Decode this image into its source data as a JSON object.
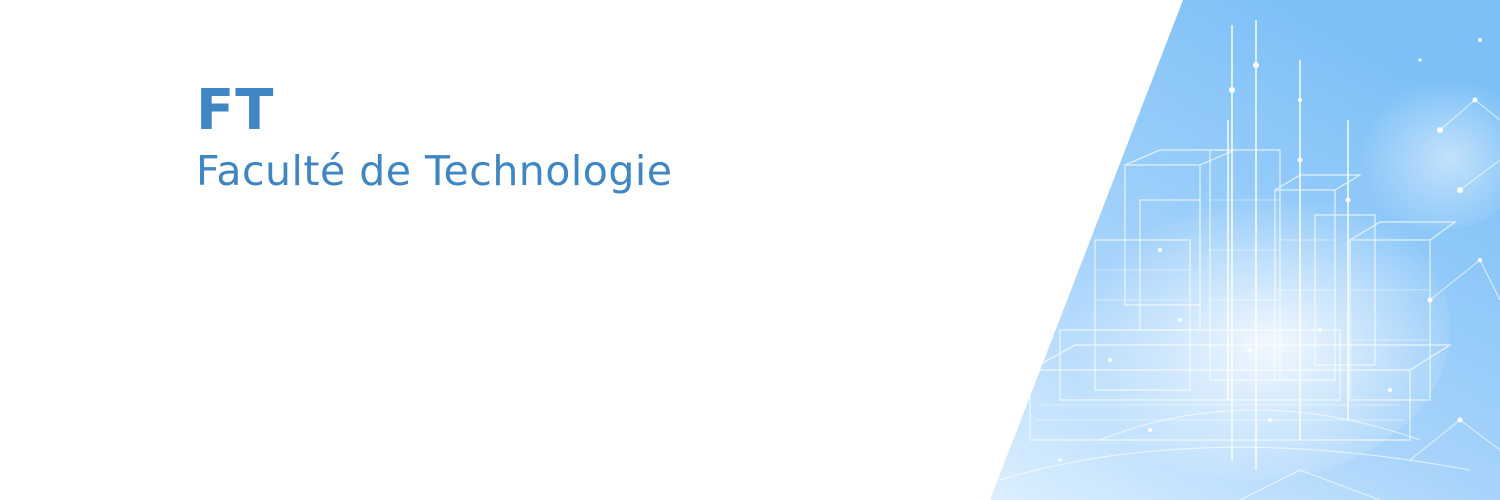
{
  "banner": {
    "abbreviation": "FT",
    "full_name": "Faculté de Technologie"
  },
  "colors": {
    "text": "#3f86c4",
    "panel_light": "#dcefff",
    "panel_mid": "#a6d3fb",
    "panel_deep": "#79bdf6",
    "line": "#ffffff"
  },
  "decoration": {
    "panel_art": "blueprint-city-network"
  }
}
